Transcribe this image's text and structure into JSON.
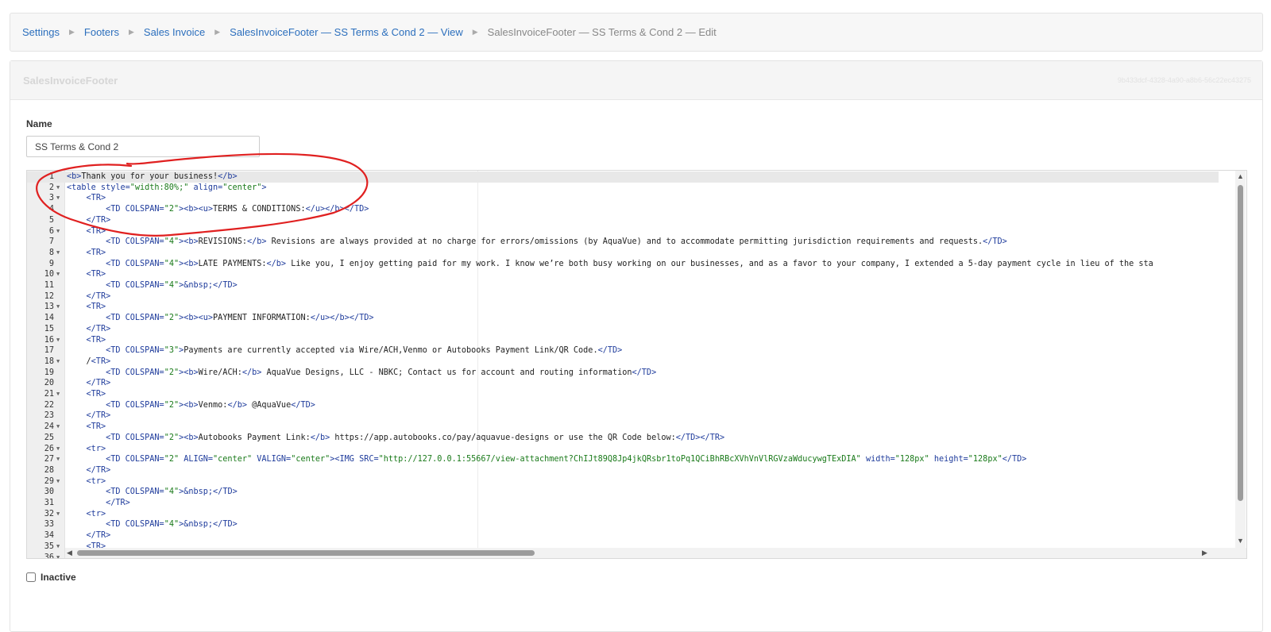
{
  "breadcrumb": [
    {
      "label": "Settings"
    },
    {
      "label": "Footers"
    },
    {
      "label": "Sales Invoice"
    },
    {
      "label": "SalesInvoiceFooter — SS Terms & Cond 2 — View"
    },
    {
      "label": "SalesInvoiceFooter — SS Terms & Cond 2 — Edit"
    }
  ],
  "panel": {
    "title": "SalesInvoiceFooter",
    "record_id": "9b433dcf-4328-4a90-a8b6-56c22ec43275"
  },
  "name_field": {
    "label": "Name",
    "value": "SS Terms & Cond 2"
  },
  "inactive": {
    "label": "Inactive",
    "checked": false
  },
  "annotation_color": "#e02020",
  "code_lines": [
    {
      "n": "1",
      "fold": false,
      "text": "<b>Thank you for your business!</b>"
    },
    {
      "n": "2",
      "fold": true,
      "text": "<table style=\"width:80%;\" align=\"center\">"
    },
    {
      "n": "3",
      "fold": true,
      "text": "    <TR>"
    },
    {
      "n": "4",
      "fold": false,
      "text": "        <TD COLSPAN=\"2\"><b><u>TERMS & CONDITIONS:</u></b></TD>"
    },
    {
      "n": "5",
      "fold": false,
      "text": "    </TR>"
    },
    {
      "n": "6",
      "fold": true,
      "text": "    <TR>"
    },
    {
      "n": "7",
      "fold": false,
      "text": "        <TD COLSPAN=\"4\"><b>REVISIONS:</b> Revisions are always provided at no charge for errors/omissions (by AquaVue) and to accommodate permitting jurisdiction requirements and requests.</TD>"
    },
    {
      "n": "8",
      "fold": true,
      "text": "    <TR>"
    },
    {
      "n": "9",
      "fold": false,
      "text": "        <TD COLSPAN=\"4\"><b>LATE PAYMENTS:</b> Like you, I enjoy getting paid for my work. I know we’re both busy working on our businesses, and as a favor to your company, I extended a 5-day payment cycle in lieu of the sta"
    },
    {
      "n": "10",
      "fold": true,
      "text": "    <TR>"
    },
    {
      "n": "11",
      "fold": false,
      "text": "        <TD COLSPAN=\"4\">&nbsp;</TD>"
    },
    {
      "n": "12",
      "fold": false,
      "text": "    </TR>"
    },
    {
      "n": "13",
      "fold": true,
      "text": "    <TR>"
    },
    {
      "n": "14",
      "fold": false,
      "text": "        <TD COLSPAN=\"2\"><b><u>PAYMENT INFORMATION:</u></b></TD>"
    },
    {
      "n": "15",
      "fold": false,
      "text": "    </TR>"
    },
    {
      "n": "16",
      "fold": true,
      "text": "    <TR>"
    },
    {
      "n": "17",
      "fold": false,
      "text": "        <TD COLSPAN=\"3\">Payments are currently accepted via Wire/ACH,Venmo or Autobooks Payment Link/QR Code.</TD>"
    },
    {
      "n": "18",
      "fold": true,
      "text": "    /<TR>"
    },
    {
      "n": "19",
      "fold": false,
      "text": "        <TD COLSPAN=\"2\"><b>Wire/ACH:</b> AquaVue Designs, LLC - NBKC; Contact us for account and routing information</TD>"
    },
    {
      "n": "20",
      "fold": false,
      "text": "    </TR>"
    },
    {
      "n": "21",
      "fold": true,
      "text": "    <TR>"
    },
    {
      "n": "22",
      "fold": false,
      "text": "        <TD COLSPAN=\"2\"><b>Venmo:</b> @AquaVue</TD>"
    },
    {
      "n": "23",
      "fold": false,
      "text": "    </TR>"
    },
    {
      "n": "24",
      "fold": true,
      "text": "    <TR>"
    },
    {
      "n": "25",
      "fold": false,
      "text": "        <TD COLSPAN=\"2\"><b>Autobooks Payment Link:</b> https://app.autobooks.co/pay/aquavue-designs or use the QR Code below:</TD></TR>"
    },
    {
      "n": "26",
      "fold": true,
      "text": "    <tr>"
    },
    {
      "n": "27",
      "fold": true,
      "text": "        <TD COLSPAN=\"2\" ALIGN=\"center\" VALIGN=\"center\"><IMG SRC=\"http://127.0.0.1:55667/view-attachment?ChIJt89Q8Jp4jkQRsbr1toPq1QCiBhRBcXVhVnVlRGVzaWducywgTExDIA\" width=\"128px\" height=\"128px\"</TD>"
    },
    {
      "n": "28",
      "fold": false,
      "text": "    </TR>"
    },
    {
      "n": "29",
      "fold": true,
      "text": "    <tr>"
    },
    {
      "n": "30",
      "fold": false,
      "text": "        <TD COLSPAN=\"4\">&nbsp;</TD>"
    },
    {
      "n": "31",
      "fold": false,
      "text": "        </TR>"
    },
    {
      "n": "32",
      "fold": true,
      "text": "    <tr>"
    },
    {
      "n": "33",
      "fold": false,
      "text": "        <TD COLSPAN=\"4\">&nbsp;</TD>"
    },
    {
      "n": "34",
      "fold": false,
      "text": "    </TR>"
    },
    {
      "n": "35",
      "fold": true,
      "text": "    <TR>"
    },
    {
      "n": "36",
      "fold": true,
      "text": ""
    }
  ]
}
